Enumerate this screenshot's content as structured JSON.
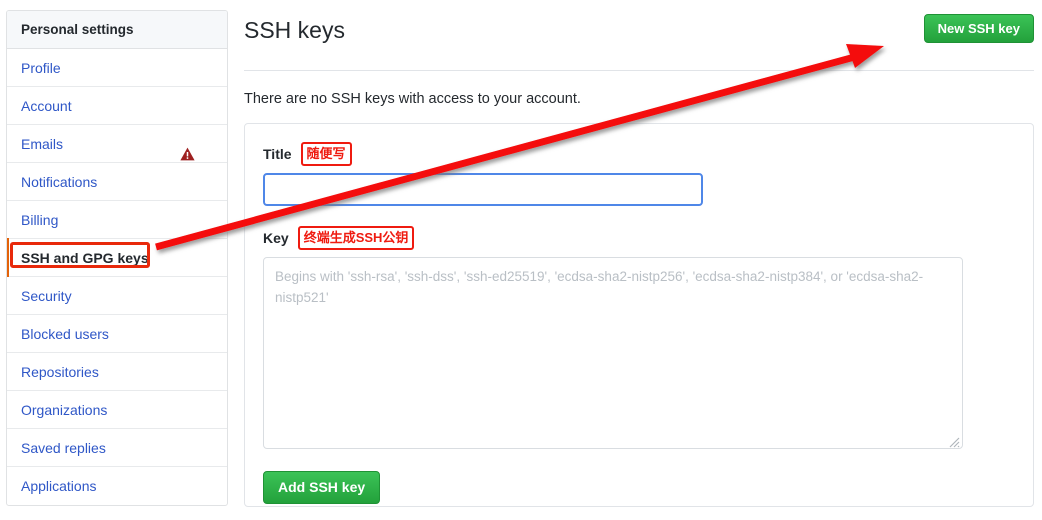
{
  "sidebar": {
    "header": "Personal settings",
    "items": [
      {
        "label": "Profile",
        "active": false,
        "warn": false
      },
      {
        "label": "Account",
        "active": false,
        "warn": false
      },
      {
        "label": "Emails",
        "active": false,
        "warn": true
      },
      {
        "label": "Notifications",
        "active": false,
        "warn": false
      },
      {
        "label": "Billing",
        "active": false,
        "warn": false
      },
      {
        "label": "SSH and GPG keys",
        "active": true,
        "warn": false
      },
      {
        "label": "Security",
        "active": false,
        "warn": false
      },
      {
        "label": "Blocked users",
        "active": false,
        "warn": false
      },
      {
        "label": "Repositories",
        "active": false,
        "warn": false
      },
      {
        "label": "Organizations",
        "active": false,
        "warn": false
      },
      {
        "label": "Saved replies",
        "active": false,
        "warn": false
      },
      {
        "label": "Applications",
        "active": false,
        "warn": false
      }
    ]
  },
  "main": {
    "title": "SSH keys",
    "new_key_button": "New SSH key",
    "empty_message": "There are no SSH keys with access to your account.",
    "form": {
      "title_label": "Title",
      "title_annotation": "随便写",
      "title_value": "",
      "title_placeholder": "",
      "key_label": "Key",
      "key_annotation": "终端生成SSH公钥",
      "key_value": "",
      "key_placeholder": "Begins with 'ssh-rsa', 'ssh-dss', 'ssh-ed25519', 'ecdsa-sha2-nistp256', 'ecdsa-sha2-nistp384', or 'ecdsa-sha2-nistp521'",
      "submit_button": "Add SSH key"
    }
  },
  "annotations": {
    "arrow_color": "#f40d0d",
    "box_color": "#e8290b",
    "active_marker_color": "#e36209"
  },
  "colors": {
    "link": "#2f57c7",
    "green_button": "#2aa83f",
    "warning": "#9e2020",
    "focus_border": "#4f87e8"
  }
}
